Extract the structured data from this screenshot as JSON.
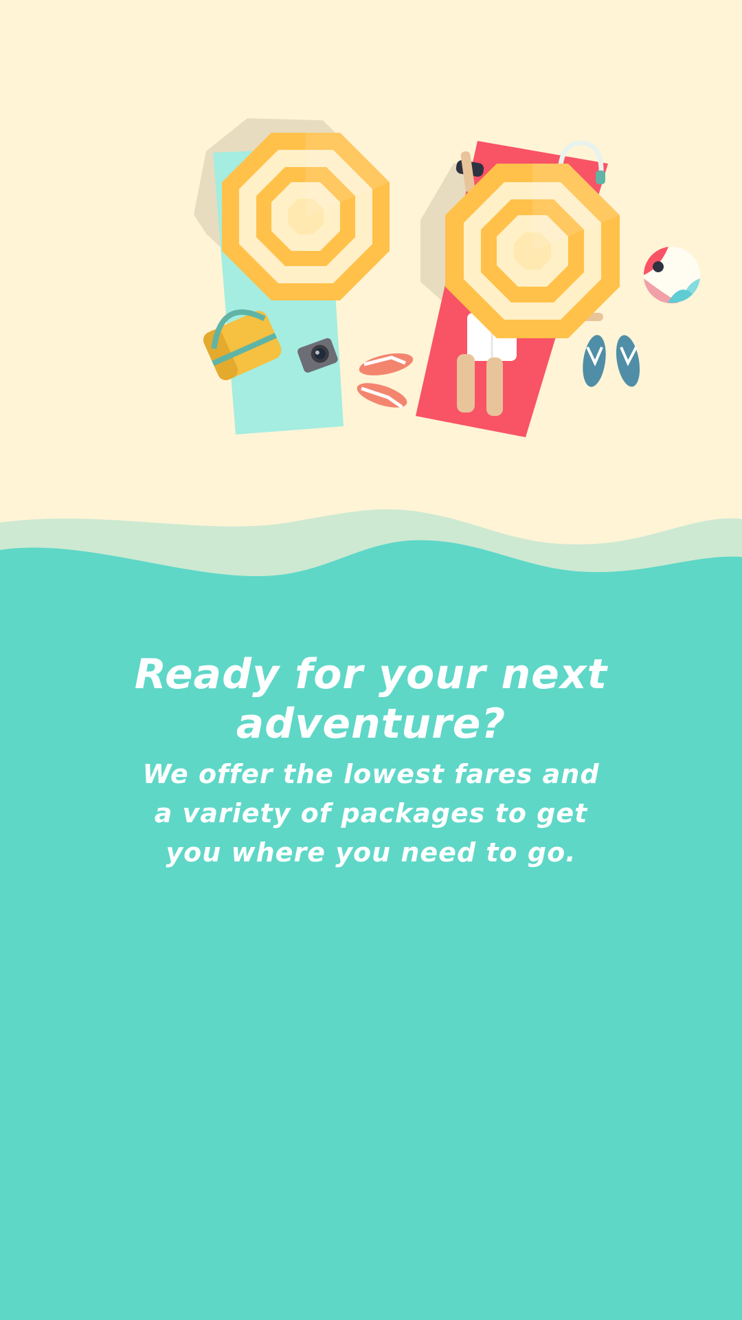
{
  "onboarding": {
    "headline": "Ready for your next adventure?",
    "subtext": "We offer the lowest fares and a variety of packages to get you where you need to go."
  },
  "colors": {
    "sand": "#fff4d6",
    "sea": "#5ed7c7",
    "foam": "#cde9d2",
    "umbrella_yellow": "#ffc14a",
    "umbrella_cream": "#fff0c7",
    "towel_mint": "#a4ede0",
    "towel_red": "#f95366",
    "sandal_coral": "#f3856f",
    "sandal_blue": "#4f8ea6",
    "text": "#ffffff"
  },
  "icons": [
    "beach-umbrella-icon",
    "beach-towel-icon",
    "beach-bag-icon",
    "camera-icon",
    "flip-flops-icon",
    "headphones-icon",
    "beach-ball-icon",
    "sunbather-icon"
  ]
}
